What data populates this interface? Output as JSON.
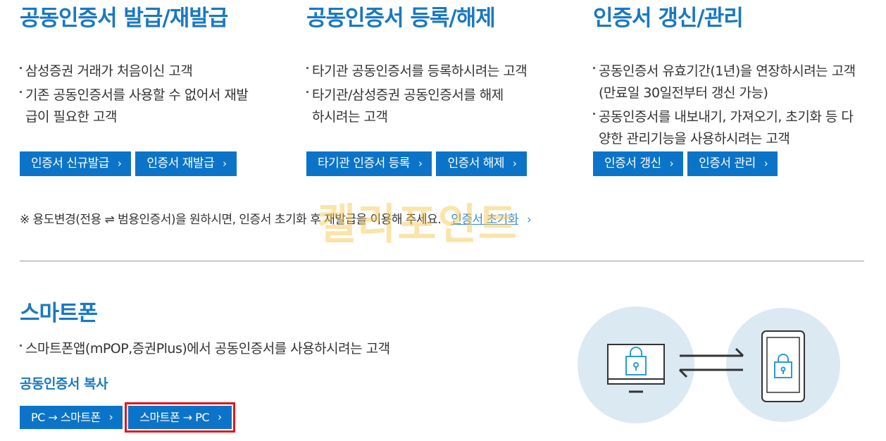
{
  "columns": [
    {
      "title": "공동인증서 발급/재발급",
      "bullets": [
        "삼성증권 거래가 처음이신 고객",
        "기존 공동인증서를 사용할 수 없어서 재발급이 필요한 고객"
      ],
      "buttons": [
        "인증서 신규발급",
        "인증서 재발급"
      ]
    },
    {
      "title": "공동인증서 등록/해제",
      "bullets": [
        "타기관 공동인증서를 등록하시려는 고객",
        "타기관/삼성증권 공동인증서를 해제하시려는 고객"
      ],
      "buttons": [
        "타기관 인증서 등록",
        "인증서 해제"
      ]
    },
    {
      "title": "인증서 갱신/관리",
      "bullets": [
        "공동인증서 유효기간(1년)을 연장하시려는 고객 (만료일 30일전부터 갱신 가능)",
        "공동인증서를 내보내기, 가져오기, 초기화 등 다양한 관리기능을 사용하시려는 고객"
      ],
      "buttons": [
        "인증서 갱신",
        "인증서 관리"
      ]
    }
  ],
  "notice": {
    "text": "※ 용도변경(전용 ⇌ 범용인증서)을 원하시면, 인증서 초기화 후 재발급을 이용해 주세요.",
    "link": "인증서 초기화"
  },
  "watermark": "켈리포인트",
  "smartphone": {
    "title": "스마트폰",
    "bullet": "스마트폰앱(mPOP,증권Plus)에서 공동인증서를 사용하시려는 고객",
    "subtitle": "공동인증서 복사",
    "buttons": [
      "PC → 스마트폰",
      "스마트폰 → PC"
    ]
  },
  "chevron": "›",
  "colors": {
    "accent": "#1a78c2",
    "button": "#0c74c8",
    "highlight": "#e8141b",
    "illustration_bg": "#dbe9f3"
  }
}
